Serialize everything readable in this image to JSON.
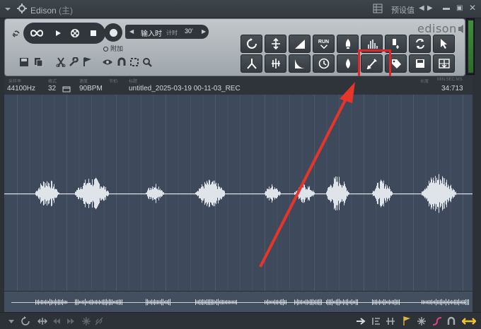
{
  "titlebar": {
    "app_name": "Edison",
    "owner": "(主)",
    "preset_label": "预设值"
  },
  "transport": {
    "input_label": "输入时",
    "meter_label": "计时",
    "time_value": "30'",
    "add_label": "附加"
  },
  "toolbar": {
    "logo": "edison",
    "run_label": "RUN"
  },
  "info": {
    "samplerate_caption": "采样率",
    "samplerate": "44100Hz",
    "format_caption": "格式",
    "bits": "32",
    "tempo_caption": "速度",
    "tempo": "90BPM",
    "loop_caption": "节拍",
    "title_caption": "标题",
    "filename": "untitled_2025-03-19 00-11-03_REC",
    "time_caption": "长度",
    "time_caption_2": "MIN:SEC:MS",
    "duration": "34:713"
  },
  "colors": {
    "highlight": "#e0262c",
    "arrow": "#e8352a",
    "waveform": "#dfe3ea",
    "background": "#3e4a5b"
  }
}
